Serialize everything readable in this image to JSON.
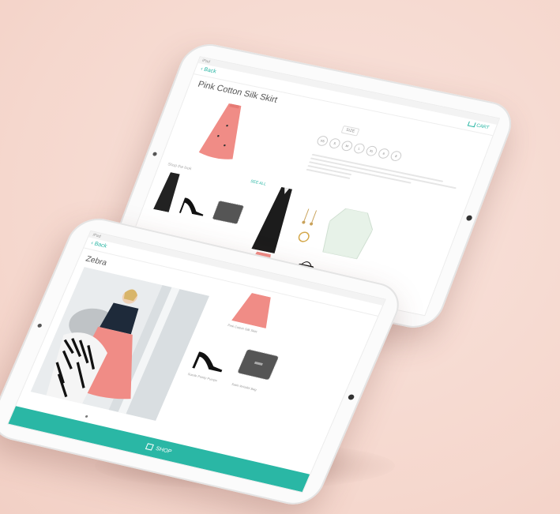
{
  "back_ipad": {
    "status": "iPad",
    "nav": {
      "back_label": "‹ Back",
      "cart_label": "CART"
    },
    "product": {
      "title": "Pink Cotton Silk Skirt",
      "size_label": "SIZE",
      "sizes": [
        "XS",
        "S",
        "M",
        "L",
        "XL",
        "6",
        "8"
      ]
    },
    "section_label": "Shop the look",
    "section_link": "SEE ALL"
  },
  "front_ipad": {
    "status": "iPad",
    "nav": {
      "back_label": "‹ Back"
    },
    "look_title": "Zebra",
    "captions": {
      "skirt": "Pink Cotton Silk Skirt",
      "shoes": "Suede Pointy Pumps",
      "bag": "Satin Wristlet Bag"
    },
    "shop_button": "SHOP"
  },
  "colors": {
    "accent": "#2ab7a5",
    "background": "#f6dbd3",
    "skirt": "#f08c86"
  }
}
